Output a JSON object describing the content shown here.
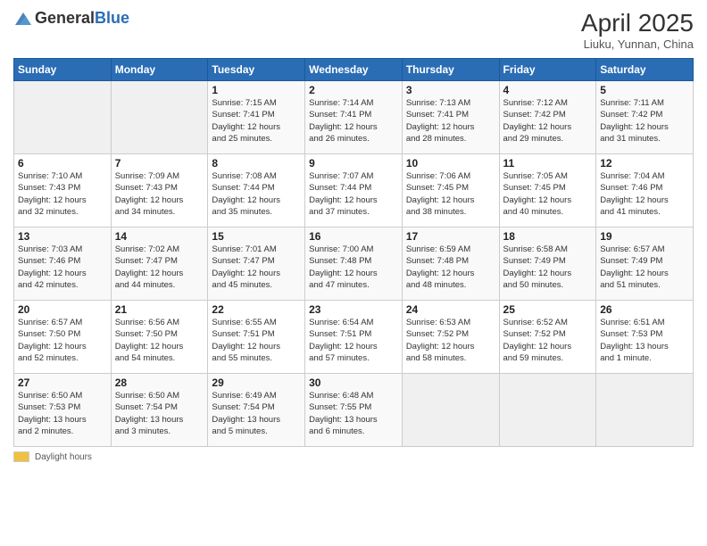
{
  "header": {
    "logo_general": "General",
    "logo_blue": "Blue",
    "month_title": "April 2025",
    "location": "Liuku, Yunnan, China"
  },
  "days_of_week": [
    "Sunday",
    "Monday",
    "Tuesday",
    "Wednesday",
    "Thursday",
    "Friday",
    "Saturday"
  ],
  "footer": {
    "daylight_label": "Daylight hours"
  },
  "weeks": [
    [
      {
        "day": "",
        "info": ""
      },
      {
        "day": "",
        "info": ""
      },
      {
        "day": "1",
        "info": "Sunrise: 7:15 AM\nSunset: 7:41 PM\nDaylight: 12 hours\nand 25 minutes."
      },
      {
        "day": "2",
        "info": "Sunrise: 7:14 AM\nSunset: 7:41 PM\nDaylight: 12 hours\nand 26 minutes."
      },
      {
        "day": "3",
        "info": "Sunrise: 7:13 AM\nSunset: 7:41 PM\nDaylight: 12 hours\nand 28 minutes."
      },
      {
        "day": "4",
        "info": "Sunrise: 7:12 AM\nSunset: 7:42 PM\nDaylight: 12 hours\nand 29 minutes."
      },
      {
        "day": "5",
        "info": "Sunrise: 7:11 AM\nSunset: 7:42 PM\nDaylight: 12 hours\nand 31 minutes."
      }
    ],
    [
      {
        "day": "6",
        "info": "Sunrise: 7:10 AM\nSunset: 7:43 PM\nDaylight: 12 hours\nand 32 minutes."
      },
      {
        "day": "7",
        "info": "Sunrise: 7:09 AM\nSunset: 7:43 PM\nDaylight: 12 hours\nand 34 minutes."
      },
      {
        "day": "8",
        "info": "Sunrise: 7:08 AM\nSunset: 7:44 PM\nDaylight: 12 hours\nand 35 minutes."
      },
      {
        "day": "9",
        "info": "Sunrise: 7:07 AM\nSunset: 7:44 PM\nDaylight: 12 hours\nand 37 minutes."
      },
      {
        "day": "10",
        "info": "Sunrise: 7:06 AM\nSunset: 7:45 PM\nDaylight: 12 hours\nand 38 minutes."
      },
      {
        "day": "11",
        "info": "Sunrise: 7:05 AM\nSunset: 7:45 PM\nDaylight: 12 hours\nand 40 minutes."
      },
      {
        "day": "12",
        "info": "Sunrise: 7:04 AM\nSunset: 7:46 PM\nDaylight: 12 hours\nand 41 minutes."
      }
    ],
    [
      {
        "day": "13",
        "info": "Sunrise: 7:03 AM\nSunset: 7:46 PM\nDaylight: 12 hours\nand 42 minutes."
      },
      {
        "day": "14",
        "info": "Sunrise: 7:02 AM\nSunset: 7:47 PM\nDaylight: 12 hours\nand 44 minutes."
      },
      {
        "day": "15",
        "info": "Sunrise: 7:01 AM\nSunset: 7:47 PM\nDaylight: 12 hours\nand 45 minutes."
      },
      {
        "day": "16",
        "info": "Sunrise: 7:00 AM\nSunset: 7:48 PM\nDaylight: 12 hours\nand 47 minutes."
      },
      {
        "day": "17",
        "info": "Sunrise: 6:59 AM\nSunset: 7:48 PM\nDaylight: 12 hours\nand 48 minutes."
      },
      {
        "day": "18",
        "info": "Sunrise: 6:58 AM\nSunset: 7:49 PM\nDaylight: 12 hours\nand 50 minutes."
      },
      {
        "day": "19",
        "info": "Sunrise: 6:57 AM\nSunset: 7:49 PM\nDaylight: 12 hours\nand 51 minutes."
      }
    ],
    [
      {
        "day": "20",
        "info": "Sunrise: 6:57 AM\nSunset: 7:50 PM\nDaylight: 12 hours\nand 52 minutes."
      },
      {
        "day": "21",
        "info": "Sunrise: 6:56 AM\nSunset: 7:50 PM\nDaylight: 12 hours\nand 54 minutes."
      },
      {
        "day": "22",
        "info": "Sunrise: 6:55 AM\nSunset: 7:51 PM\nDaylight: 12 hours\nand 55 minutes."
      },
      {
        "day": "23",
        "info": "Sunrise: 6:54 AM\nSunset: 7:51 PM\nDaylight: 12 hours\nand 57 minutes."
      },
      {
        "day": "24",
        "info": "Sunrise: 6:53 AM\nSunset: 7:52 PM\nDaylight: 12 hours\nand 58 minutes."
      },
      {
        "day": "25",
        "info": "Sunrise: 6:52 AM\nSunset: 7:52 PM\nDaylight: 12 hours\nand 59 minutes."
      },
      {
        "day": "26",
        "info": "Sunrise: 6:51 AM\nSunset: 7:53 PM\nDaylight: 13 hours\nand 1 minute."
      }
    ],
    [
      {
        "day": "27",
        "info": "Sunrise: 6:50 AM\nSunset: 7:53 PM\nDaylight: 13 hours\nand 2 minutes."
      },
      {
        "day": "28",
        "info": "Sunrise: 6:50 AM\nSunset: 7:54 PM\nDaylight: 13 hours\nand 3 minutes."
      },
      {
        "day": "29",
        "info": "Sunrise: 6:49 AM\nSunset: 7:54 PM\nDaylight: 13 hours\nand 5 minutes."
      },
      {
        "day": "30",
        "info": "Sunrise: 6:48 AM\nSunset: 7:55 PM\nDaylight: 13 hours\nand 6 minutes."
      },
      {
        "day": "",
        "info": ""
      },
      {
        "day": "",
        "info": ""
      },
      {
        "day": "",
        "info": ""
      }
    ]
  ]
}
